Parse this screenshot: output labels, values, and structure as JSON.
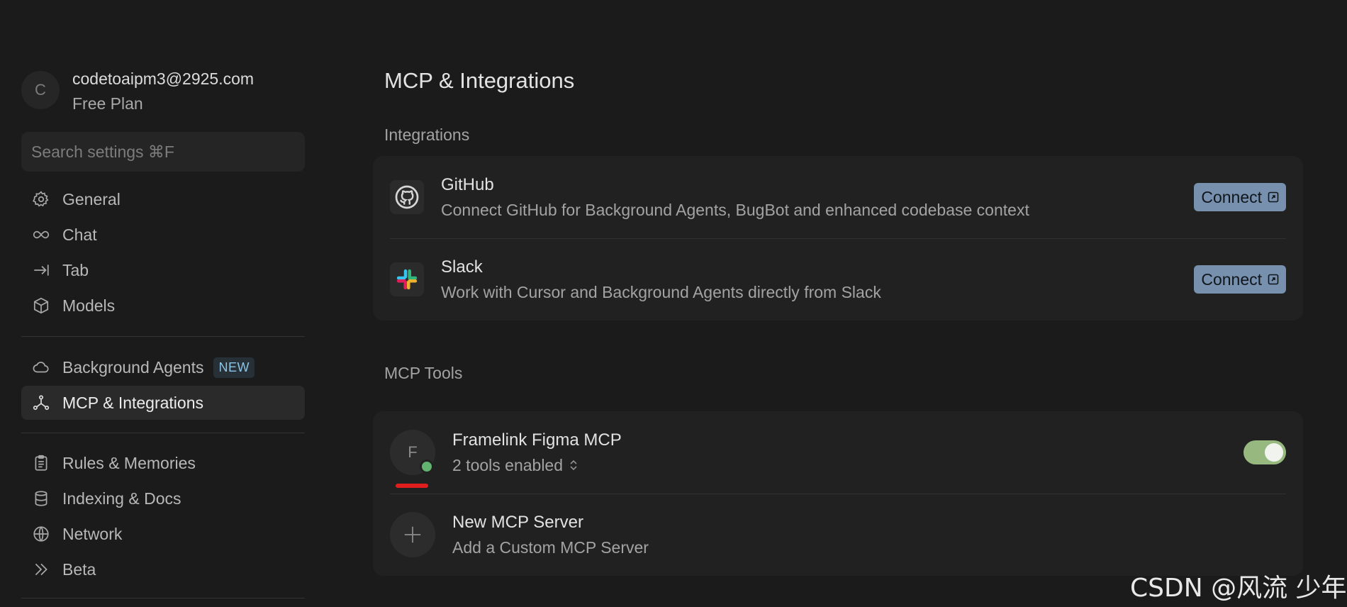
{
  "user": {
    "avatar_letter": "C",
    "email": "codetoaipm3@2925.com",
    "plan": "Free Plan"
  },
  "search": {
    "placeholder": "Search settings ⌘F"
  },
  "nav": {
    "group1": [
      {
        "label": "General",
        "icon": "gear-icon"
      },
      {
        "label": "Chat",
        "icon": "infinity-icon"
      },
      {
        "label": "Tab",
        "icon": "tab-arrow-icon"
      },
      {
        "label": "Models",
        "icon": "cube-icon"
      }
    ],
    "group2": [
      {
        "label": "Background Agents",
        "icon": "cloud-icon",
        "badge": "NEW"
      },
      {
        "label": "MCP & Integrations",
        "icon": "network-node-icon",
        "active": true
      }
    ],
    "group3": [
      {
        "label": "Rules & Memories",
        "icon": "clipboard-icon"
      },
      {
        "label": "Indexing & Docs",
        "icon": "database-icon"
      },
      {
        "label": "Network",
        "icon": "globe-icon"
      },
      {
        "label": "Beta",
        "icon": "double-chevron-icon"
      }
    ]
  },
  "main": {
    "title": "MCP & Integrations",
    "integrations_label": "Integrations",
    "integrations": [
      {
        "name": "GitHub",
        "description": "Connect GitHub for Background Agents, BugBot and enhanced codebase context",
        "button": "Connect",
        "icon": "github-icon"
      },
      {
        "name": "Slack",
        "description": "Work with Cursor and Background Agents directly from Slack",
        "button": "Connect",
        "icon": "slack-icon"
      }
    ],
    "mcp_label": "MCP Tools",
    "mcp_tools": [
      {
        "avatar_letter": "F",
        "name": "Framelink Figma MCP",
        "status": "2 tools enabled",
        "enabled": true,
        "status_color": "#62b370"
      }
    ],
    "new_server": {
      "title": "New MCP Server",
      "subtitle": "Add a Custom MCP Server"
    }
  },
  "watermark": "CSDN @风流 少年",
  "colors": {
    "accent_button": "#7690ae",
    "toggle_on": "#97b97f",
    "badge_text": "#8cc4e6",
    "annotation_red": "#e01e1e"
  }
}
